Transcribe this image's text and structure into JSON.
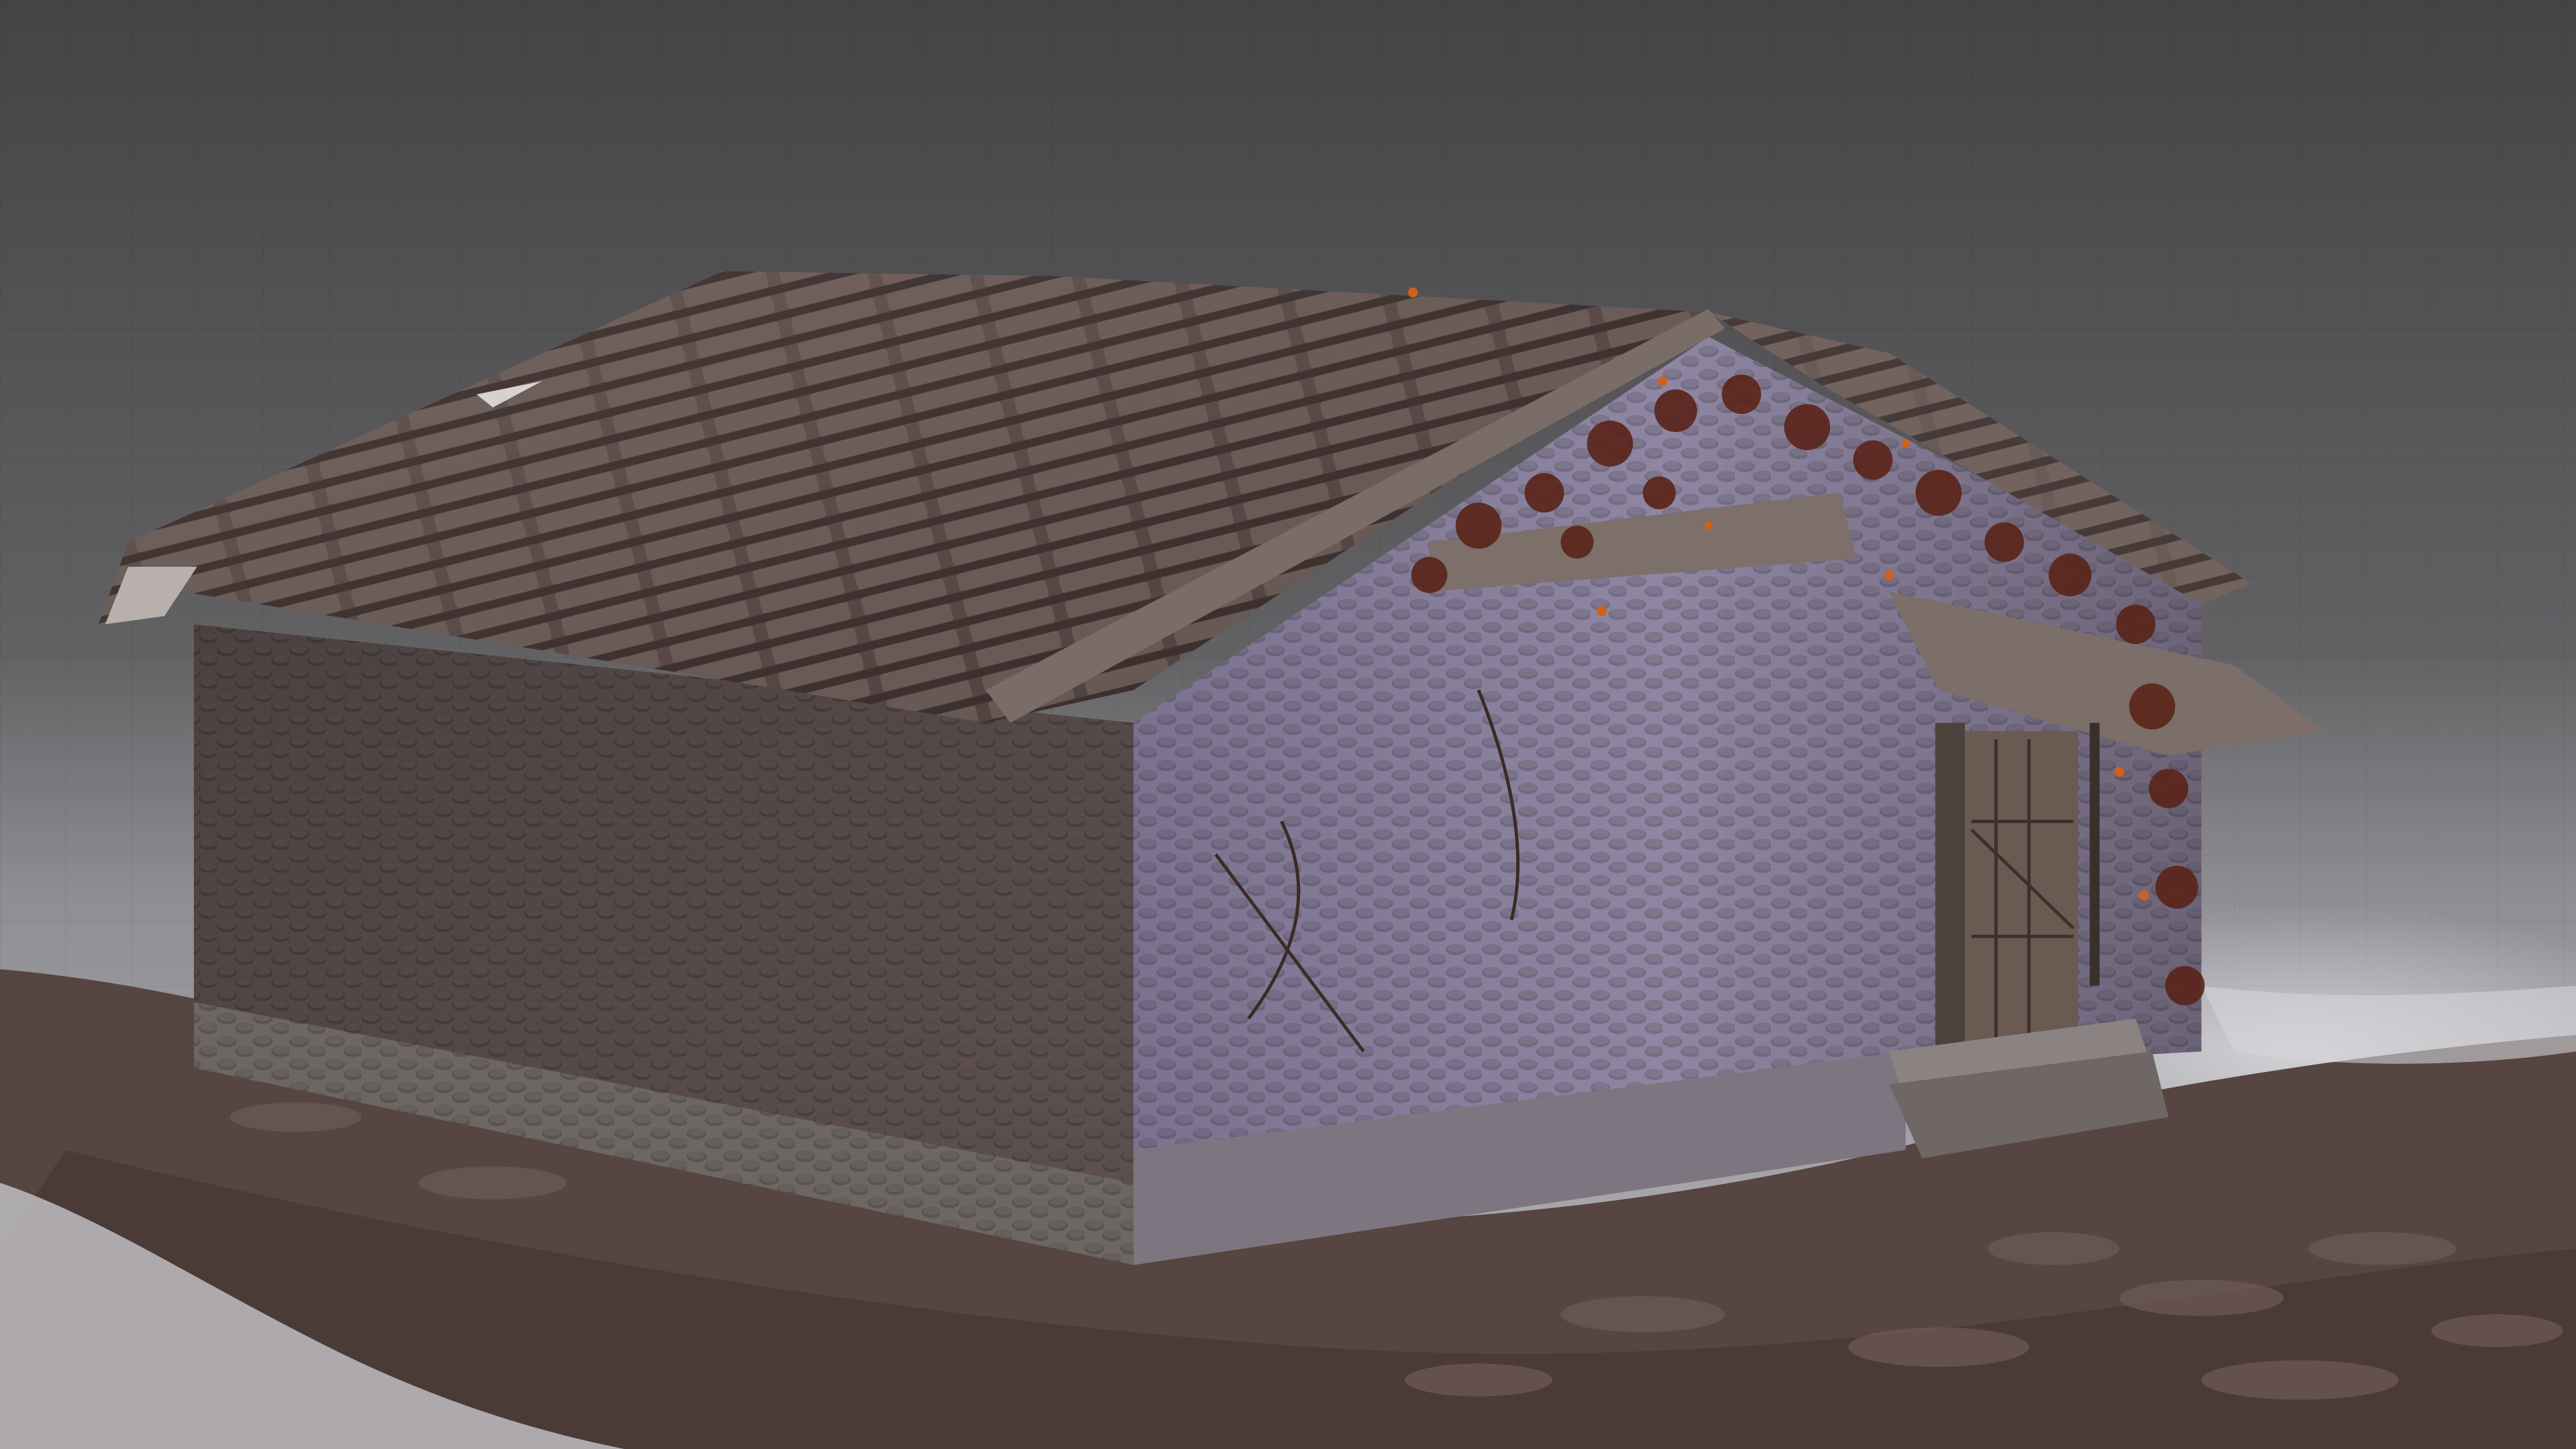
{
  "scene": {
    "subject": "stone-cottage",
    "colors": {
      "backdrop_top": "#4a4a4c",
      "backdrop_bottom": "#8e8e92",
      "floor": "#c9c9cd",
      "stone_wall": "#5f5154",
      "stone_wall_lit": "#8a7f98",
      "roof_planks": "#5a4a46",
      "ivy": "#6e2a1c",
      "ivy_highlight": "#d0601e",
      "door_wood": "#6a5a52",
      "ground_debris": "#5b4840"
    }
  }
}
